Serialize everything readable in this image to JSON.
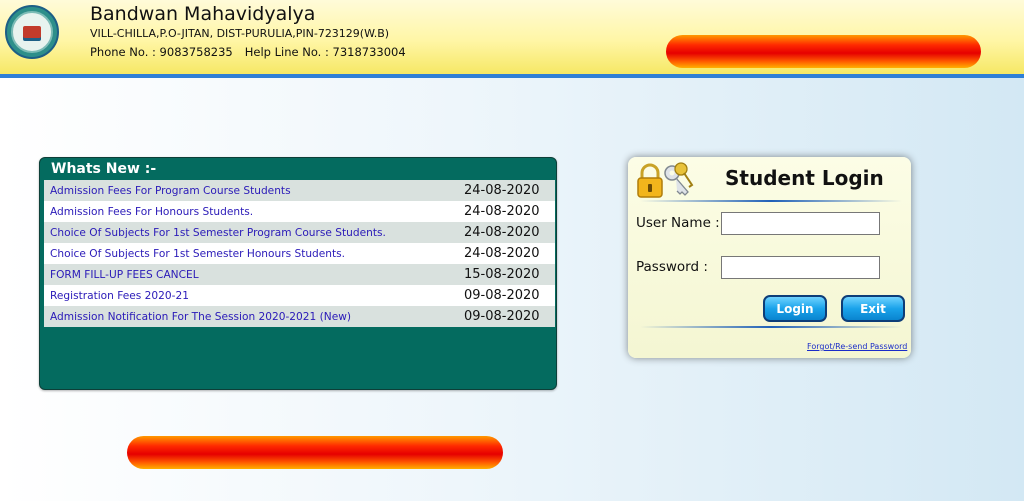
{
  "header": {
    "site_name": "Bandwan Mahavidyalya",
    "address": "VILL-CHILLA,P.O-JITAN, DIST-PURULIA,PIN-723129(W.B)",
    "phone_label": "Phone No. : 9083758235",
    "helpline_label": "Help Line No. : 7318733004"
  },
  "whats_new": {
    "title": "Whats New :-",
    "items": [
      {
        "text": "Admission Fees For Program Course Students",
        "date": "24-08-2020"
      },
      {
        "text": "Admission Fees For Honours Students.",
        "date": "24-08-2020"
      },
      {
        "text": "Choice Of Subjects For 1st Semester Program Course Students.",
        "date": "24-08-2020"
      },
      {
        "text": "Choice Of Subjects For 1st Semester Honours Students.",
        "date": "24-08-2020"
      },
      {
        "text": "FORM FILL-UP FEES CANCEL",
        "date": "15-08-2020"
      },
      {
        "text": "Registration Fees 2020-21",
        "date": "09-08-2020"
      },
      {
        "text": "Admission Notification For The Session 2020-2021 (New)",
        "date": "09-08-2020"
      }
    ]
  },
  "login": {
    "title": "Student Login",
    "username_label": "User Name :",
    "username_value": "",
    "password_label": "Password :",
    "password_value": "",
    "login_button": "Login",
    "exit_button": "Exit",
    "forgot_link": "Forgot/Re-send Password"
  },
  "colors": {
    "header_bg": "#fff6a6",
    "header_border": "#2f7fd6",
    "news_bg": "#046b5f",
    "news_link": "#2a1ab8",
    "marquee": "#ff2a00",
    "button": "#1aa3ea"
  },
  "icons": {
    "logo": "college-emblem-icon",
    "lock": "lock-and-keys-icon"
  }
}
